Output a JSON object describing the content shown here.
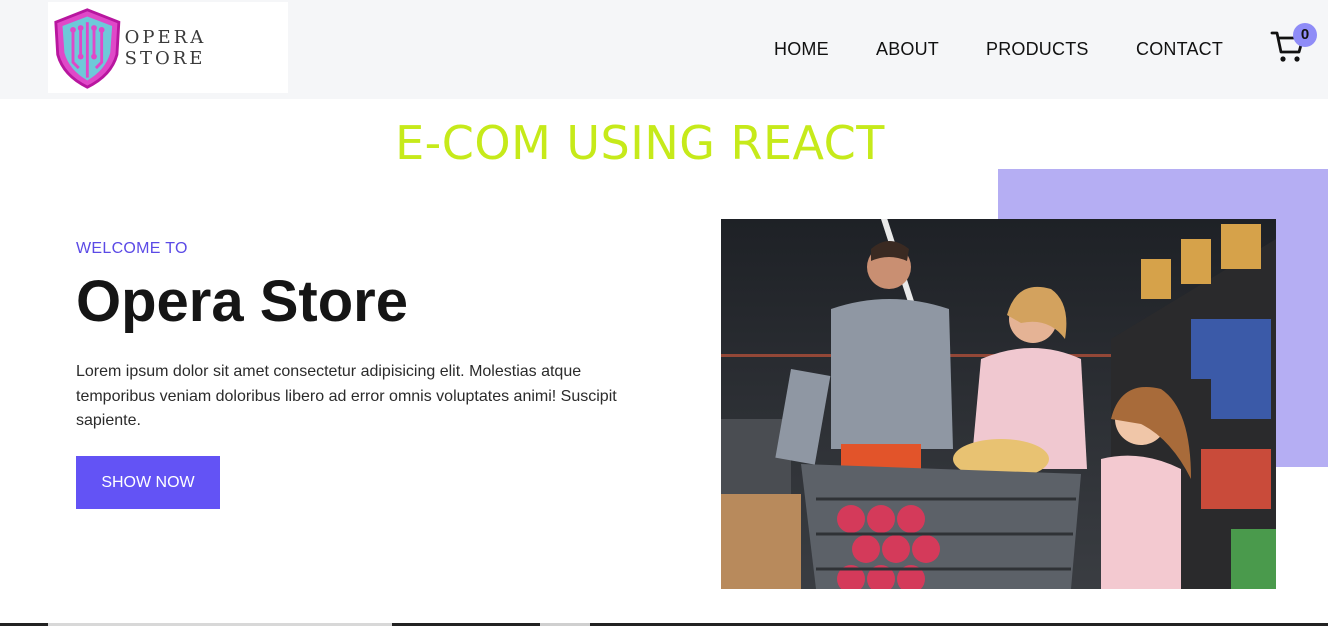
{
  "header": {
    "logo_text": "OPERA STORE",
    "nav": {
      "home": "HOME",
      "about": "ABOUT",
      "products": "PRODUCTS",
      "contact": "CONTACT"
    },
    "cart_count": "0",
    "icons": {
      "logo": "shield-circuit-icon",
      "cart": "shopping-cart-icon"
    }
  },
  "banner": {
    "title": "E-COM USING REACT"
  },
  "hero": {
    "welcome": "WELCOME TO",
    "heading": "Opera Store",
    "description": "Lorem ipsum dolor sit amet consectetur adipisicing elit. Molestias atque temporibus veniam doloribus libero ad error omnis voluptates animi! Suscipit sapiente.",
    "button": "SHOW NOW",
    "image": "family-shopping-with-cart-in-supermarket"
  },
  "colors": {
    "accent": "#6353f5",
    "banner_title": "#c6ea1a",
    "purple_block": "#b5aef3",
    "cart_badge": "#8f8cf7"
  }
}
